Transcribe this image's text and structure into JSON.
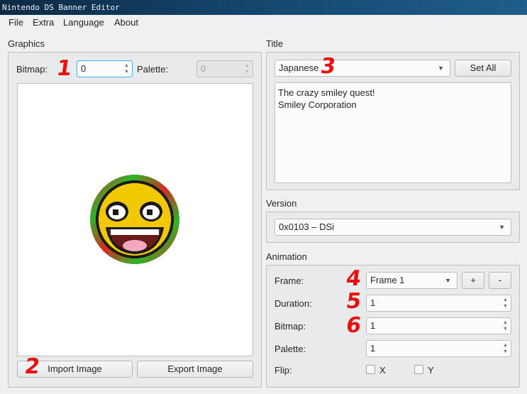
{
  "window": {
    "title": "Nintendo DS Banner Editor"
  },
  "menu": [
    "File",
    "Extra",
    "Language",
    "About"
  ],
  "graphics": {
    "group_title": "Graphics",
    "bitmap_label": "Bitmap:",
    "bitmap_value": "0",
    "palette_label": "Palette:",
    "palette_value": "0",
    "import_button": "Import Image",
    "export_button": "Export Image",
    "preview": {
      "description": "smiley-face-banner-icon",
      "colors": {
        "face": "#f2c800",
        "outline": "#1a1a1a",
        "mouth": "#6b1a1a",
        "tongue": "#f3a8c0",
        "border_green": "#2fb52a",
        "border_red": "#d62a1f"
      }
    }
  },
  "title_group": {
    "group_title": "Title",
    "language_selected": "Japanese",
    "set_all_button": "Set All",
    "text_line1": "The crazy smiley quest!",
    "text_line2": "Smiley Corporation"
  },
  "version_group": {
    "group_title": "Version",
    "selected": "0x0103 – DSi"
  },
  "animation": {
    "group_title": "Animation",
    "frame_label": "Frame:",
    "frame_selected": "Frame 1",
    "add_button": "+",
    "remove_button": "-",
    "duration_label": "Duration:",
    "duration_value": "1",
    "bitmap_label": "Bitmap:",
    "bitmap_value": "1",
    "palette_label": "Palette:",
    "palette_value": "1",
    "flip_label": "Flip:",
    "flip_x_label": "X",
    "flip_y_label": "Y"
  },
  "annotations": [
    "1",
    "2",
    "3",
    "4",
    "5",
    "6"
  ],
  "colors": {
    "annotation": "#e8110f",
    "focus": "#3daee9",
    "titlebar": "#164a73"
  }
}
